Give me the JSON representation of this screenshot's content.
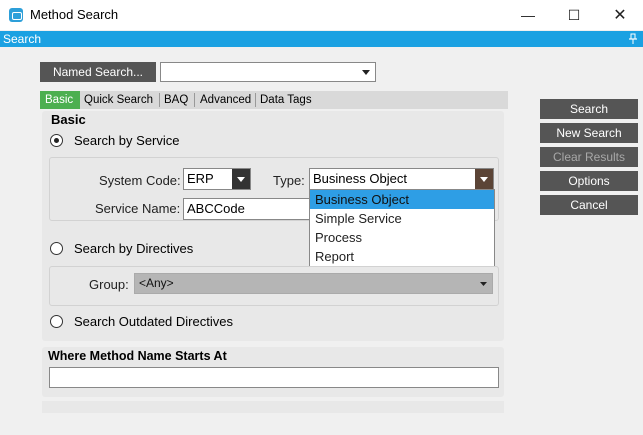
{
  "window": {
    "title": "Method Search",
    "minimize_glyph": "—",
    "maximize_glyph": "☐",
    "close_glyph": "✕"
  },
  "search_strip": {
    "label": "Search",
    "pin_icon": "pin-icon"
  },
  "named_search": {
    "button_label": "Named Search...",
    "value": ""
  },
  "tabs": [
    {
      "label": "Basic",
      "active": true
    },
    {
      "label": "Quick Search"
    },
    {
      "label": "BAQ"
    },
    {
      "label": "Advanced"
    },
    {
      "label": "Data Tags"
    }
  ],
  "basic": {
    "heading": "Basic",
    "search_by_service": {
      "label": "Search by Service",
      "checked": true,
      "system_code": {
        "label": "System Code:",
        "value": "ERP"
      },
      "type": {
        "label": "Type:",
        "value": "Business Object",
        "options": [
          "Business Object",
          "Simple Service",
          "Process",
          "Report"
        ],
        "selected_index": 0
      },
      "service_name": {
        "label": "Service Name:",
        "value": "ABCCode"
      }
    },
    "search_by_directives": {
      "label": "Search by Directives",
      "checked": false,
      "group": {
        "label": "Group:",
        "value": "<Any>"
      }
    },
    "search_outdated": {
      "label": "Search Outdated Directives",
      "checked": false
    },
    "where_method": {
      "heading": "Where Method Name Starts At",
      "value": ""
    }
  },
  "actions": {
    "search": "Search",
    "new_search": "New Search",
    "clear_results": "Clear Results",
    "options": "Options",
    "cancel": "Cancel"
  },
  "colors": {
    "accent_blue": "#1ba1e2",
    "active_tab_green": "#4caf50",
    "button_dark": "#555555",
    "selection_blue": "#2e9ee5"
  }
}
